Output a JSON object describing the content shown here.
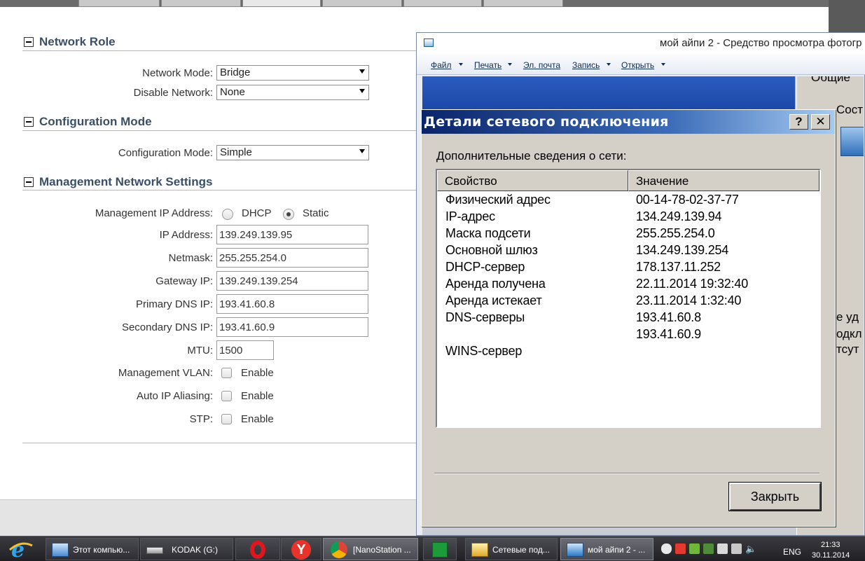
{
  "router": {
    "sections": [
      {
        "title": "Network Role"
      },
      {
        "title": "Configuration Mode"
      },
      {
        "title": "Management Network Settings"
      }
    ],
    "network_mode": {
      "label": "Network Mode:",
      "value": "Bridge"
    },
    "disable_network": {
      "label": "Disable Network:",
      "value": "None"
    },
    "configuration_mode": {
      "label": "Configuration Mode:",
      "value": "Simple"
    },
    "management_ip": {
      "label": "Management IP Address:",
      "option_dhcp": "DHCP",
      "option_static": "Static",
      "selected": "Static"
    },
    "ip_address": {
      "label": "IP Address:",
      "value": "139.249.139.95"
    },
    "netmask": {
      "label": "Netmask:",
      "value": "255.255.254.0"
    },
    "gateway_ip": {
      "label": "Gateway IP:",
      "value": "139.249.139.254"
    },
    "primary_dns": {
      "label": "Primary DNS IP:",
      "value": "193.41.60.8"
    },
    "secondary_dns": {
      "label": "Secondary DNS IP:",
      "value": "193.41.60.9"
    },
    "mtu": {
      "label": "MTU:",
      "value": "1500"
    },
    "management_vlan": {
      "label": "Management VLAN:",
      "option": "Enable",
      "checked": false
    },
    "auto_ip_aliasing": {
      "label": "Auto IP Aliasing:",
      "option": "Enable",
      "checked": false
    },
    "stp": {
      "label": "STP:",
      "option": "Enable",
      "checked": false
    }
  },
  "viewer": {
    "title": "мой айпи 2 - Средство просмотра фотогр",
    "menu": {
      "file": "Файл",
      "print": "Печать",
      "email": "Эл. почта",
      "burn": "Запись",
      "open": "Открыть"
    },
    "bg_fragments": [
      "Общие",
      "Сост",
      "е уд",
      "одкл",
      "тсут"
    ]
  },
  "dialog": {
    "title": "Детали сетевого подключения",
    "help_label": "?",
    "close_x_label": "✕",
    "subtitle": "Дополнительные сведения о сети:",
    "columns": {
      "property": "Свойство",
      "value": "Значение"
    },
    "rows": [
      {
        "property": "Физический адрес",
        "value": "00-14-78-02-37-77"
      },
      {
        "property": "IP-адрес",
        "value": "134.249.139.94"
      },
      {
        "property": "Маска подсети",
        "value": "255.255.254.0"
      },
      {
        "property": "Основной шлюз",
        "value": "134.249.139.254"
      },
      {
        "property": "DHCP-сервер",
        "value": "178.137.11.252"
      },
      {
        "property": "Аренда получена",
        "value": "22.11.2014 19:32:40"
      },
      {
        "property": "Аренда истекает",
        "value": "23.11.2014 1:32:40"
      },
      {
        "property": "DNS-серверы",
        "value": "193.41.60.8"
      },
      {
        "property": "",
        "value": "193.41.60.9"
      },
      {
        "property": "WINS-сервер",
        "value": ""
      }
    ],
    "close_button": "Закрыть"
  },
  "taskbar": {
    "tasks": [
      {
        "label": "Этот компью..."
      },
      {
        "label": "KODAK (G:)"
      },
      {
        "label": ""
      },
      {
        "label": ""
      },
      {
        "label": "[NanoStation ..."
      },
      {
        "label": ""
      },
      {
        "label": "Сетевые под..."
      },
      {
        "label": "мой айпи 2 - ..."
      }
    ],
    "language": "ENG",
    "time": "21:33",
    "date": "30.11.2014"
  }
}
